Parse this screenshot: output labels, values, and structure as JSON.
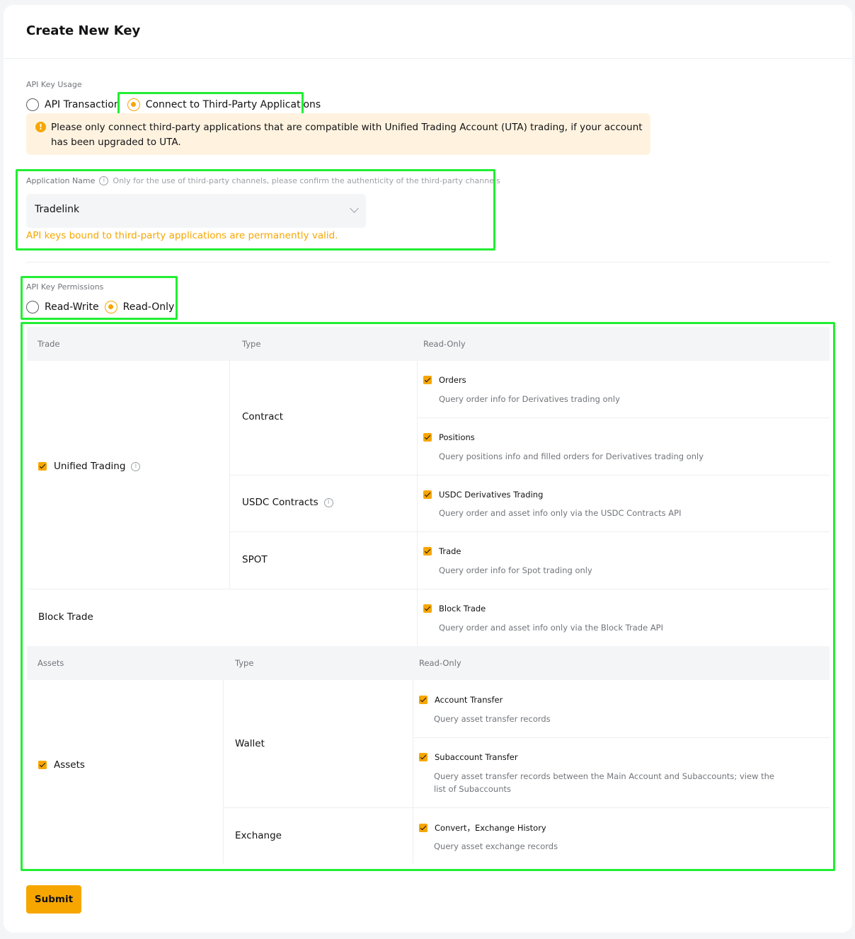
{
  "header": {
    "title": "Create New Key"
  },
  "usage": {
    "label": "API Key Usage",
    "options": [
      "API Transaction",
      "Connect to Third-Party Applications"
    ],
    "selected": "Connect to Third-Party Applications",
    "notice": "Please only connect third-party applications that are compatible with Unified Trading Account (UTA) trading, if your account has been upgraded to UTA."
  },
  "application": {
    "label": "Application Name",
    "hint": "Only for the use of third-party channels, please confirm the authenticity of the third-party channels",
    "value": "Tradelink",
    "note": "API keys bound to third-party applications are permanently valid."
  },
  "permissions": {
    "label": "API Key Permissions",
    "options": [
      "Read-Write",
      "Read-Only"
    ],
    "selected": "Read-Only"
  },
  "trade_table": {
    "headers": [
      "Trade",
      "Type",
      "Read-Only"
    ],
    "unified_label": "Unified Trading",
    "types": [
      "Contract",
      "USDC Contracts",
      "SPOT"
    ],
    "block_trade_label": "Block Trade",
    "perms": [
      {
        "title": "Orders",
        "desc": "Query order info for Derivatives trading only"
      },
      {
        "title": "Positions",
        "desc": "Query positions info and filled orders for Derivatives trading only"
      },
      {
        "title": "USDC Derivatives Trading",
        "desc": "Query order and asset info only via the USDC Contracts API"
      },
      {
        "title": "Trade",
        "desc": "Query order info for Spot trading only"
      },
      {
        "title": "Block Trade",
        "desc": "Query order and asset info only via the Block Trade API"
      }
    ]
  },
  "assets_table": {
    "headers": [
      "Assets",
      "Type",
      "Read-Only"
    ],
    "assets_label": "Assets",
    "types": [
      "Wallet",
      "Exchange"
    ],
    "perms": [
      {
        "title": "Account Transfer",
        "desc": "Query asset transfer records"
      },
      {
        "title": "Subaccount Transfer",
        "desc": "Query asset transfer records between the Main Account and Subaccounts; view the list of Subaccounts"
      },
      {
        "title": "Convert，Exchange History",
        "desc": "Query asset exchange records"
      }
    ]
  },
  "submit_label": "Submit",
  "colors": {
    "accent": "#f7a600",
    "highlight": "#22ee33",
    "notice_bg": "#fff3e0"
  }
}
